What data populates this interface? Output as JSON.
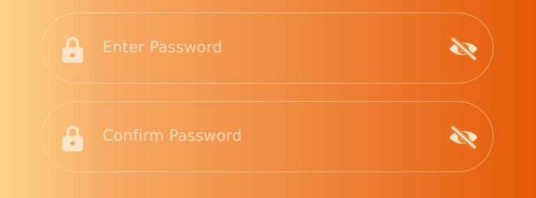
{
  "fields": [
    {
      "placeholder": "Enter Password",
      "leading_icon": "lock-icon",
      "trailing_icon": "eye-slash-icon"
    },
    {
      "placeholder": "Confirm Password",
      "leading_icon": "lock-icon",
      "trailing_icon": "eye-slash-icon"
    }
  ],
  "colors": {
    "gradient_start": "#fdd58a",
    "gradient_end": "#e55a08",
    "icon": "#fde4c4",
    "border": "#ffeccd"
  }
}
